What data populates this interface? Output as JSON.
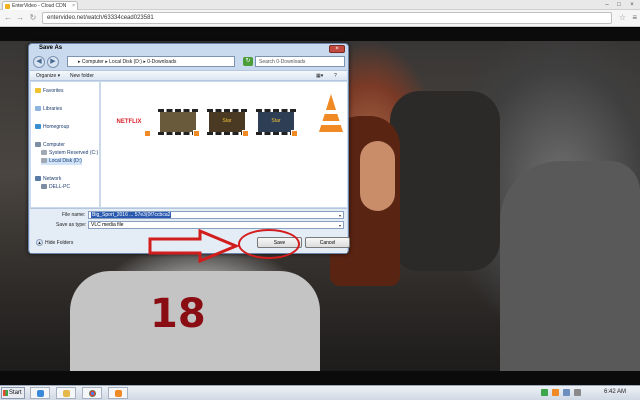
{
  "browser": {
    "tab_title": "EnterVideo - Cloud CDN",
    "tab_close": "×",
    "url": "entervideo.net/watch/63334cead023581",
    "window_controls": [
      "–",
      "□",
      "×"
    ]
  },
  "dialog": {
    "title": "Save As",
    "close": "×",
    "path": "▸ Computer ▸ Local Disk (D:) ▸ 0-Downloads",
    "search_placeholder": "Search 0-Downloads",
    "organize": "Organize ▾",
    "new_folder": "New folder",
    "nav": {
      "favorites": "Favorites",
      "libraries": "Libraries",
      "homegroup": "Homegroup",
      "computer": "Computer",
      "system_reserved": "System Reserved (C:)",
      "local_disk": "Local Disk (D:)",
      "network": "Network",
      "pc": "DELL-PC"
    },
    "file_name_label": "File name:",
    "file_name_value": "Big_Sport_2016 ... 57e3(0f7ccbca2",
    "save_type_label": "Save as type:",
    "save_type_value": "VLC media file",
    "hide_folders": "Hide Folders",
    "save_button": "Save",
    "cancel_button": "Cancel",
    "thumbnails": [
      {
        "label": "NETFLIX",
        "color": "#d81f26"
      },
      {
        "label": "",
        "color": "#6a5a3c"
      },
      {
        "label": "Star",
        "color": "#4a3a24"
      },
      {
        "label": "Star",
        "color": "#2e3e55"
      }
    ]
  },
  "video": {
    "jersey_number": "18"
  },
  "taskbar": {
    "start": "Start",
    "clock": "6:42 AM"
  }
}
